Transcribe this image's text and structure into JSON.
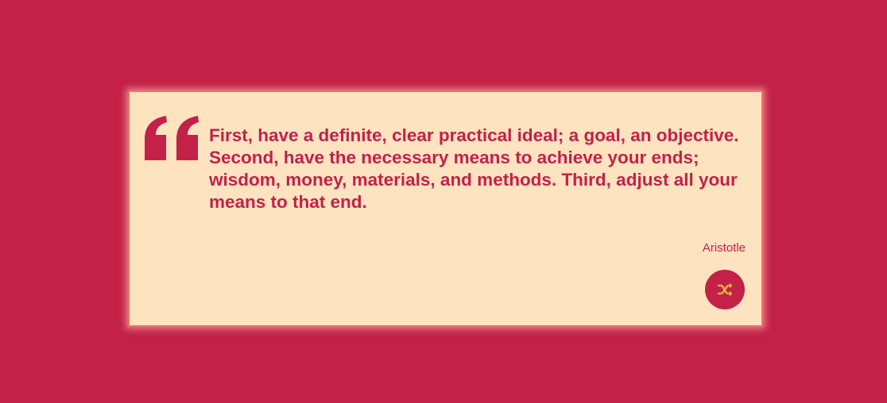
{
  "quote": {
    "text": "First, have a definite, clear practical ideal; a goal, an objective. Second, have the necessary means to achieve your ends; wisdom, money, materials, and methods. Third, adjust all your means to that end.",
    "author": "Aristotle"
  },
  "icons": {
    "quote_mark": "quote-left-icon",
    "shuffle": "shuffle-icon"
  },
  "colors": {
    "background": "#c32148",
    "card": "#fde3c0",
    "card_border": "#f07060",
    "accent": "#c32148",
    "icon": "#f2b233"
  }
}
